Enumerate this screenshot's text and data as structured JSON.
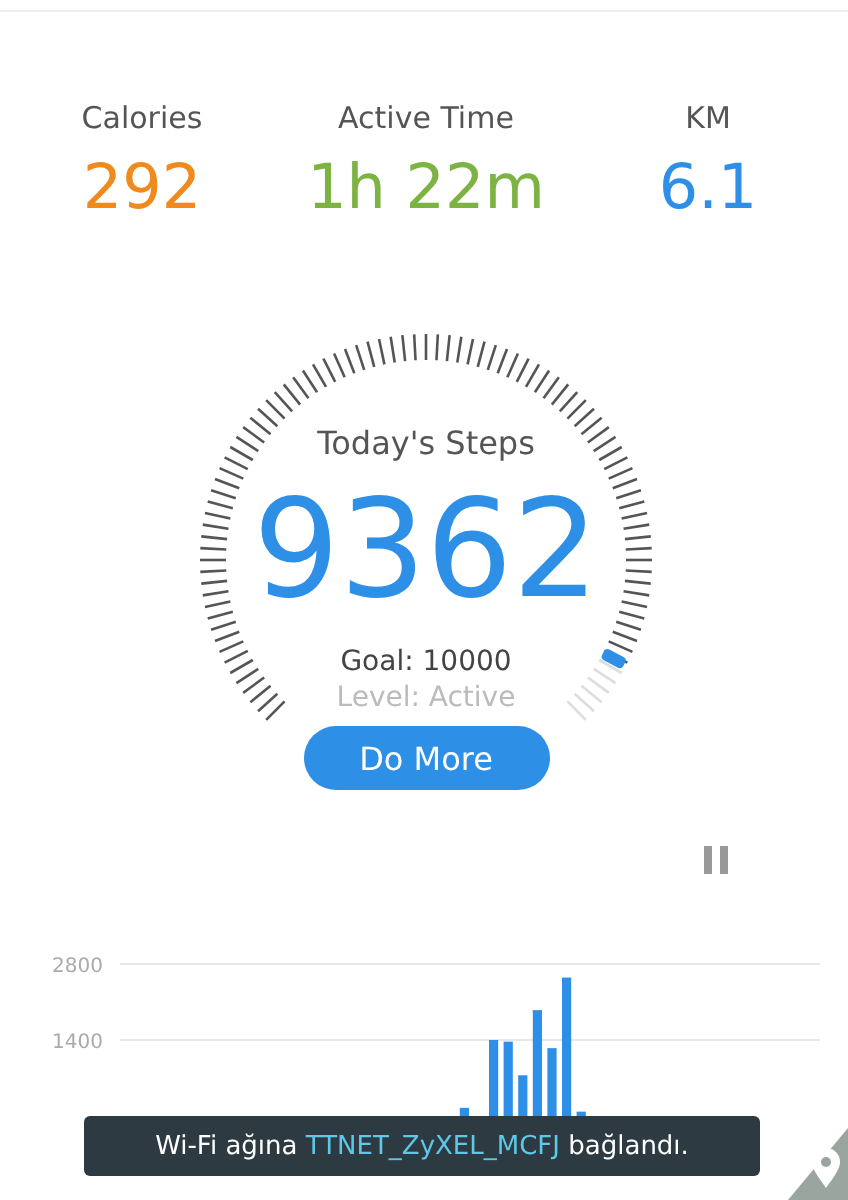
{
  "stats": [
    {
      "label": "Calories",
      "value": "292",
      "color": "#f08a1c"
    },
    {
      "label": "Active Time",
      "value": "1h 22m",
      "color": "#7cb342"
    },
    {
      "label": "KM",
      "value": "6.1",
      "color": "#2d8fe6"
    }
  ],
  "steps": {
    "title": "Today's Steps",
    "count": "9362",
    "goal": "Goal: 10000",
    "level_text": "Level: Active",
    "button": "Do More"
  },
  "paused": true,
  "chart_data": {
    "type": "bar",
    "yticks": [
      1400,
      2800
    ],
    "ylim": [
      0,
      2800
    ],
    "values": [
      0,
      0,
      0,
      0,
      0,
      0,
      0,
      0,
      0,
      0,
      0,
      0,
      0,
      0,
      0,
      0,
      0,
      0,
      0,
      0,
      0,
      0,
      0,
      150,
      0,
      1400,
      1370,
      750,
      1950,
      1250,
      2550,
      80,
      0,
      0,
      0,
      0,
      0,
      0,
      0,
      0,
      0,
      0,
      0,
      0,
      0,
      0,
      0,
      0
    ]
  },
  "toast": {
    "prefix": "Wi-Fi ağına",
    "network": "TTNET_ZyXEL_MCFJ",
    "suffix": "bağlandı."
  }
}
